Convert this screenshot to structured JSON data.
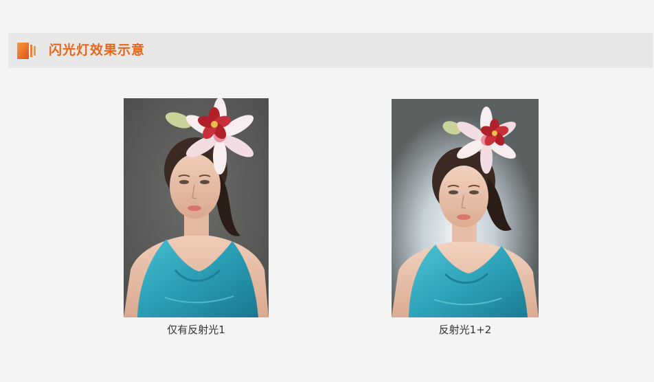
{
  "header": {
    "title": "闪光灯效果示意",
    "icon": "book-icon",
    "accent_color": "#e8661a"
  },
  "photos": [
    {
      "caption": "仅有反射光1",
      "background": "#5f605e"
    },
    {
      "caption": "反射光1+2",
      "background": "#6c7070",
      "backlight": "#e9eef2"
    }
  ],
  "colors": {
    "page_background": "#f4f4f4",
    "header_background": "#e8e8e8",
    "dress": "#2fa3b8",
    "caption_text": "#333333"
  }
}
